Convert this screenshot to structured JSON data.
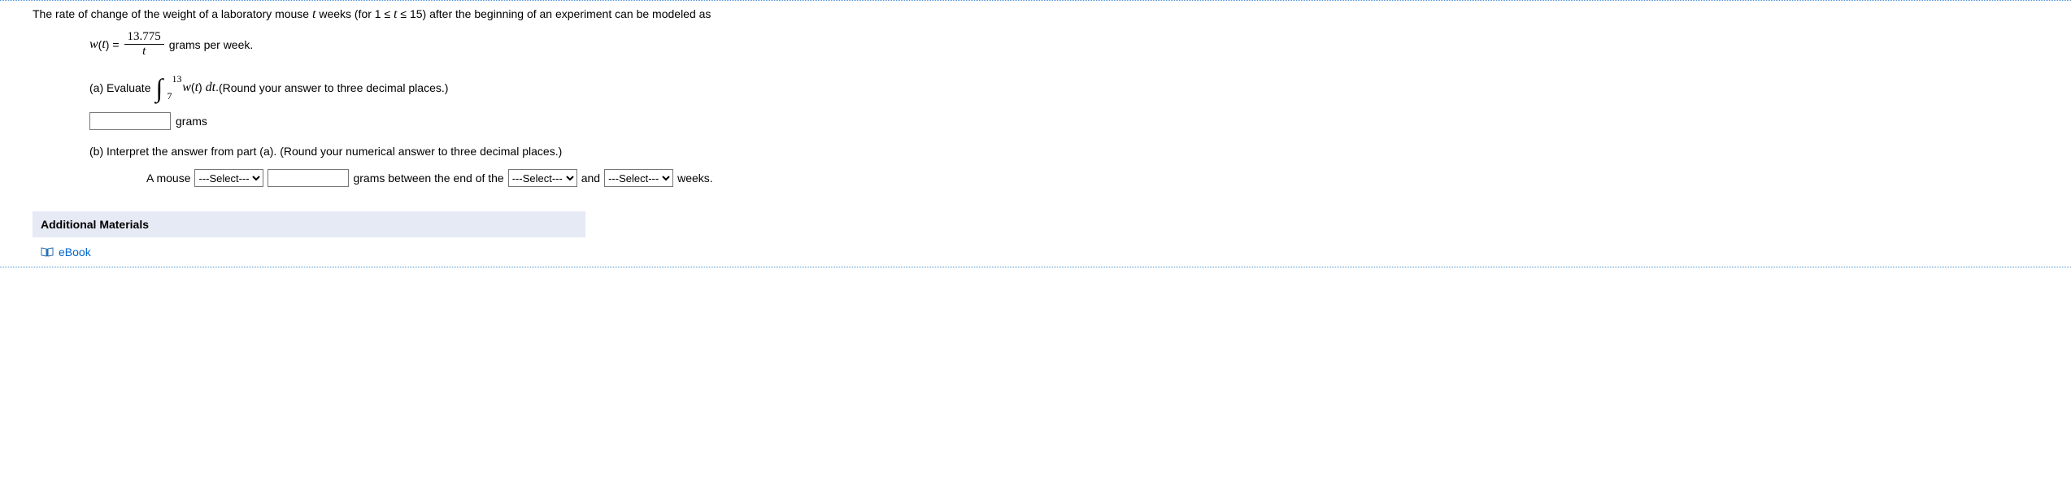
{
  "intro": {
    "pre": "The rate of change of the weight of a laboratory mouse ",
    "var": "t",
    "mid": " weeks (for 1 ≤ ",
    "var2": "t",
    "mid2": " ≤ 15) after the beginning of an experiment can be modeled as"
  },
  "formula": {
    "func": "w",
    "openParen": "(",
    "tvar": "t",
    "closeParen": ") = ",
    "numerator": "13.775",
    "denominator": "t",
    "tail": " grams per week."
  },
  "partA": {
    "label": "(a) Evaluate ",
    "upper": "13",
    "lower": "7",
    "integrand_pre": "w",
    "integrand_op": "(",
    "integrand_var": "t",
    "integrand_cl": ") ",
    "dt": "dt",
    "period": ". ",
    "round": "(Round your answer to three decimal places.)",
    "units": "grams"
  },
  "partB": {
    "label": "(b) Interpret the answer from part (a). (Round your numerical answer to three decimal places.)",
    "prefix": "A mouse",
    "select_placeholder": "---Select---",
    "mid1": "grams between the end of the",
    "mid2": "and",
    "tail": "weeks."
  },
  "additional": {
    "header": "Additional Materials",
    "ebook": "eBook"
  }
}
